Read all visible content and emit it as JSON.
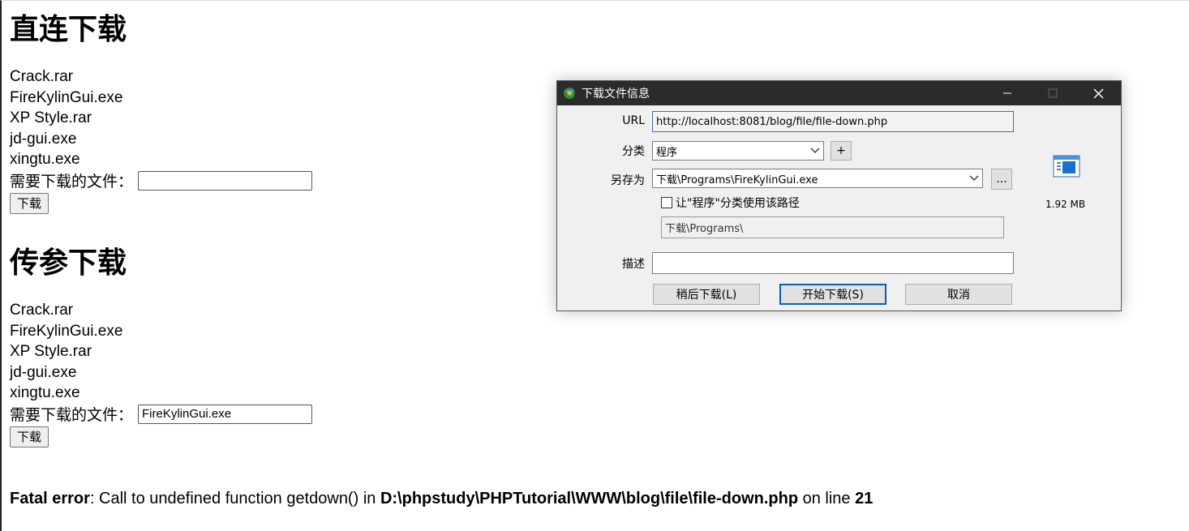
{
  "section1": {
    "heading": "直连下载",
    "files": [
      "Crack.rar",
      "FireKylinGui.exe",
      "XP Style.rar",
      "jd-gui.exe",
      "xingtu.exe"
    ],
    "input_label": "需要下载的文件：",
    "input_value": "",
    "button_label": "下载"
  },
  "section2": {
    "heading": "传参下载",
    "files": [
      "Crack.rar",
      "FireKylinGui.exe",
      "XP Style.rar",
      "jd-gui.exe",
      "xingtu.exe"
    ],
    "input_label": "需要下载的文件：",
    "input_value": "FireKylinGui.exe",
    "button_label": "下载"
  },
  "error": {
    "prefix": "Fatal error",
    "message": ": Call to undefined function getdown() in ",
    "path": "D:\\phpstudy\\PHPTutorial\\WWW\\blog\\file\\file-down.php",
    "on_line": " on line ",
    "line": "21"
  },
  "dialog": {
    "title": "下载文件信息",
    "url_label": "URL",
    "url_value": "http://localhost:8081/blog/file/file-down.php",
    "category_label": "分类",
    "category_value": "程序",
    "add_label": "+",
    "saveas_label": "另存为",
    "saveas_value": "下载\\Programs\\FireKylinGui.exe",
    "browse_label": "...",
    "checkbox_label": "让\"程序\"分类使用该路径",
    "path_value": "下载\\Programs\\",
    "desc_label": "描述",
    "desc_value": "",
    "later_button": "稍后下载(L)",
    "start_button": "开始下载(S)",
    "cancel_button": "取消",
    "file_size": "1.92 MB"
  },
  "icons": {
    "app": "idm-app-icon",
    "file": "exe-file-icon"
  },
  "colors": {
    "titlebar": "#2b2b2b",
    "dialog_bg": "#f0f0f0",
    "primary_border": "#0a5cbd"
  }
}
